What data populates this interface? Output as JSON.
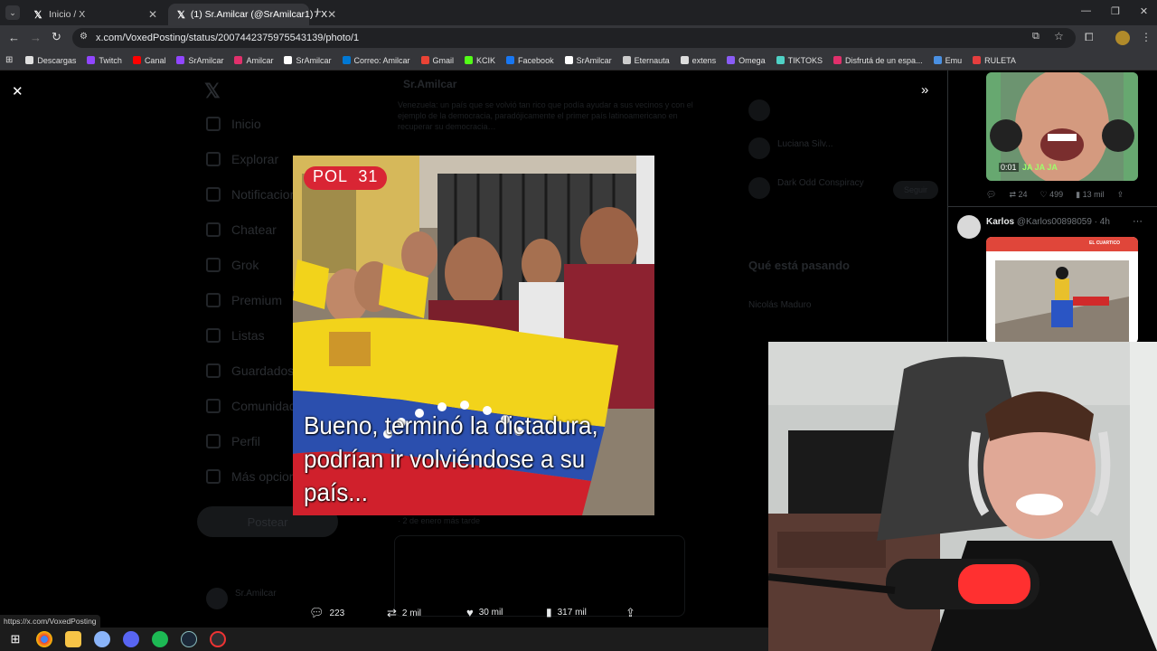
{
  "browser": {
    "tabs": [
      {
        "title": "Inicio / X"
      },
      {
        "title": "(1) Sr.Amilcar (@SrAmilcar1) / X"
      }
    ],
    "new_tab": "+",
    "url": "x.com/VoxedPosting/status/2007442375975543139/photo/1",
    "bookmarks": [
      {
        "label": "Descargas",
        "color": "#e0e0e0"
      },
      {
        "label": "Twitch",
        "color": "#9146ff"
      },
      {
        "label": "Canal",
        "color": "#ff0000"
      },
      {
        "label": "SrAmilcar",
        "color": "#9146ff"
      },
      {
        "label": "Amilcar",
        "color": "#e1306c"
      },
      {
        "label": "SrAmilcar",
        "color": "#ffffff"
      },
      {
        "label": "Correo: Amilcar",
        "color": "#0078d4"
      },
      {
        "label": "Gmail",
        "color": "#ea4335"
      },
      {
        "label": "KCIK",
        "color": "#53fc18"
      },
      {
        "label": "Facebook",
        "color": "#1877f2"
      },
      {
        "label": "SrAmilcar",
        "color": "#ffffff"
      },
      {
        "label": "Eternauta",
        "color": "#cccccc"
      },
      {
        "label": "extens",
        "color": "#dddddd"
      },
      {
        "label": "Omega",
        "color": "#8a5cf6"
      },
      {
        "label": "TIKTOKS",
        "color": "#4fd1c5"
      },
      {
        "label": "Disfrutá de un espa...",
        "color": "#e1306c"
      },
      {
        "label": "Emu",
        "color": "#4a90e2"
      },
      {
        "label": "RULETA",
        "color": "#e53e3e"
      }
    ]
  },
  "sidebar": {
    "items": [
      "Inicio",
      "Explorar",
      "Notificaciones",
      "Chatear",
      "Grok",
      "Premium",
      "Listas",
      "Guardados",
      "Comunidades",
      "Perfil",
      "Más opciones"
    ],
    "post_button": "Postear",
    "user": "Sr.Amilcar"
  },
  "background_post": {
    "author": "Sr.Amilcar",
    "text": "Venezuela: un país que se volvió tan rico que podía ayudar a sus vecinos y con el ejemplo de la democracia, paradójicamente el primer país latinoamericano en recuperar su democracia…",
    "note": "· 2 de enero más tarde"
  },
  "media_overlay": {
    "badge": "POL  31",
    "caption": "Bueno, terminó la dictadura, podrían ir volviéndose a su país...",
    "metrics": {
      "replies": "223",
      "reposts": "2 mil",
      "likes": "30 mil",
      "views": "317 mil"
    }
  },
  "right_feed": {
    "video_time": "0:01",
    "video_overlay_text": "JA JA JA",
    "tweet1_metrics": {
      "reposts": "24",
      "likes": "499",
      "views": "13 mil"
    },
    "tweet2_author": "Karlos",
    "tweet2_handle": "@Karlos00898059 · 4h",
    "tweet2_card_brand": "EL CUARTICO",
    "trends_title": "Qué está pasando",
    "trend1": "Nicolás Maduro",
    "follow_names": [
      "Luciana Silv...",
      "Dark Odd Conspiracy"
    ],
    "follow_btn": "Seguir"
  },
  "status_bar_url": "https://x.com/VoxedPosting",
  "taskbar_icons": [
    "windows-start",
    "chrome",
    "file-explorer",
    "paint-app",
    "discord",
    "spotify",
    "steam",
    "obs"
  ]
}
